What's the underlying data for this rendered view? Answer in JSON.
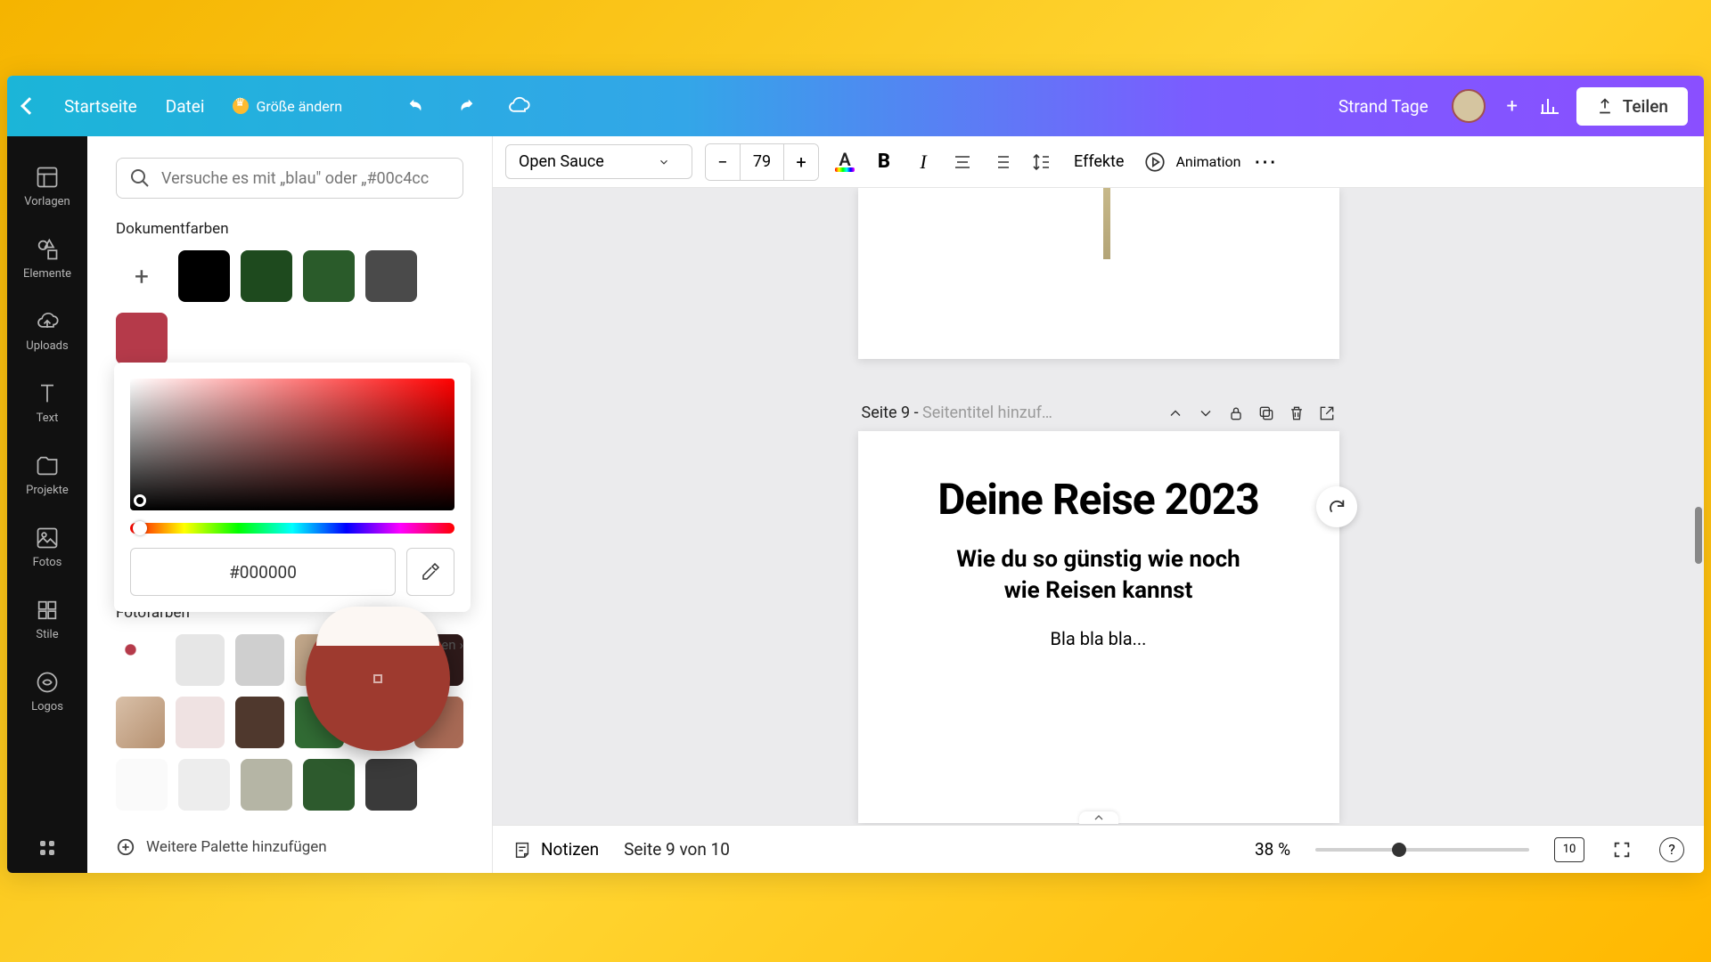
{
  "topbar": {
    "home": "Startseite",
    "file": "Datei",
    "resize": "Größe ändern",
    "project_name": "Strand Tage",
    "share": "Teilen"
  },
  "rail": {
    "templates": "Vorlagen",
    "elements": "Elemente",
    "uploads": "Uploads",
    "text": "Text",
    "projects": "Projekte",
    "photos": "Fotos",
    "styles": "Stile",
    "logos": "Logos"
  },
  "panel": {
    "search_placeholder": "Versuche es mit „blau\" oder „#00c4cc",
    "doc_colors_label": "Dokumentfarben",
    "doc_colors": [
      "#000000",
      "#1e4a1e",
      "#2a5b2a",
      "#4a4a4a",
      "#b53a4a"
    ],
    "hex_value": "#000000",
    "photo_colors_label": "Fotofarben",
    "see_all": "lle anzeigen",
    "add_palette": "Weitere Palette hinzufügen",
    "photo_rows": [
      [
        "#f0e8e8",
        "#e6e6e6",
        "#cfcfcf",
        "#c2a78a",
        "#d85a3f",
        "#2e1a1a"
      ],
      [
        "#efe2da",
        "#efe2e2",
        "#4f382d",
        "#316b34",
        "#c9a98a",
        "#a86a55"
      ],
      [
        "#fafafa",
        "#ededed",
        "#b5b5a5",
        "#2d5a2d",
        "#3a3a3a",
        ""
      ]
    ]
  },
  "toolbar": {
    "font": "Open Sauce",
    "size": "79",
    "effects": "Effekte",
    "animation": "Animation"
  },
  "page": {
    "page_prefix": "Seite 9 - ",
    "page_title_placeholder": "Seitentitel hinzuf…",
    "h1": "Deine Reise 2023",
    "h2a": "Wie du so günstig wie noch",
    "h2b": "wie Reisen kannst",
    "body": "Bla bla bla..."
  },
  "bottom": {
    "notes": "Notizen",
    "page_of": "Seite 9 von 10",
    "zoom": "38 %",
    "grid": "10"
  }
}
